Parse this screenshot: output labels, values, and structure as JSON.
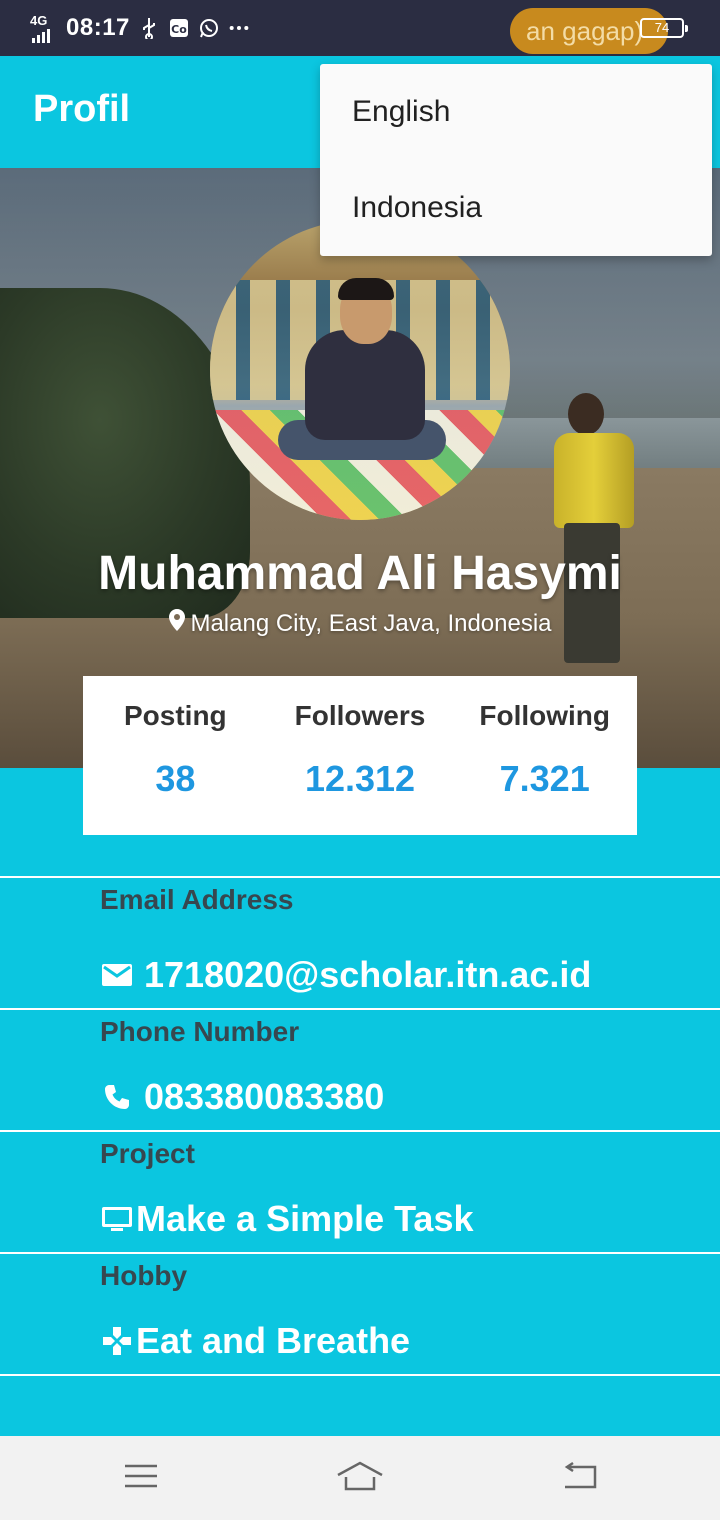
{
  "status_bar": {
    "network": "4G",
    "time": "08:17",
    "notification_pill_text": "an gagap)",
    "battery_level": "74"
  },
  "app_bar": {
    "title": "Profil"
  },
  "language_menu": {
    "items": [
      "English",
      "Indonesia"
    ]
  },
  "profile": {
    "name": "Muhammad Ali Hasymi",
    "location": "Malang City, East Java, Indonesia"
  },
  "stats": [
    {
      "label": "Posting",
      "value": "38"
    },
    {
      "label": "Followers",
      "value": "12.312"
    },
    {
      "label": "Following",
      "value": "7.321"
    }
  ],
  "info": [
    {
      "label": "Email Address",
      "value": "1718020@scholar.itn.ac.id",
      "icon": "email-icon"
    },
    {
      "label": "Phone Number",
      "value": "083380083380",
      "icon": "phone-icon"
    },
    {
      "label": "Project",
      "value": "Make a Simple Task",
      "icon": "monitor-icon"
    },
    {
      "label": "Hobby",
      "value": "Eat and Breathe",
      "icon": "gamepad-icon"
    }
  ],
  "colors": {
    "accent": "#0bc6e0",
    "stat_value": "#1e97e0",
    "label": "#37474f"
  }
}
